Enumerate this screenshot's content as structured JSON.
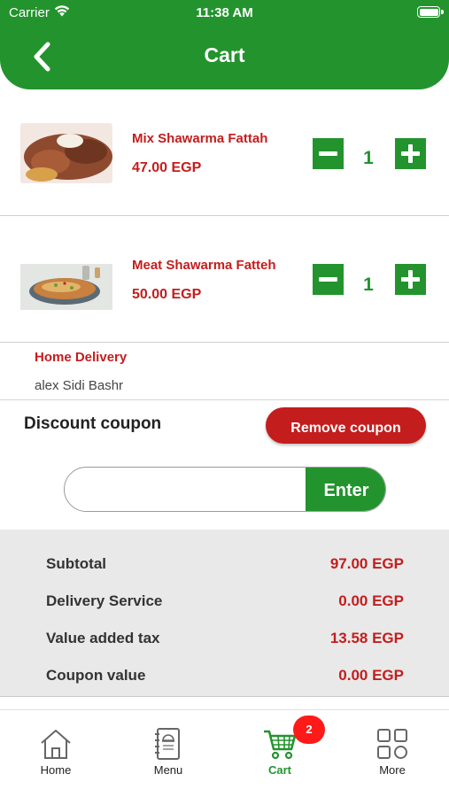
{
  "status_bar": {
    "carrier": "Carrier",
    "time": "11:38 AM"
  },
  "header": {
    "title": "Cart"
  },
  "cart": {
    "items": [
      {
        "name": "Mix Shawarma Fattah",
        "price": "47.00 EGP",
        "quantity": "1",
        "image": "shawarma-fattah-photo"
      },
      {
        "name": "Meat Shawarma Fatteh",
        "price": "50.00 EGP",
        "quantity": "1",
        "image": "meat-fatteh-photo"
      }
    ]
  },
  "delivery": {
    "type": "Home Delivery",
    "address": "alex  Sidi Bashr"
  },
  "coupon": {
    "label": "Discount coupon",
    "remove_label": "Remove coupon",
    "input_value": "",
    "enter_label": "Enter"
  },
  "summary": {
    "rows": [
      {
        "label": "Subtotal",
        "value": "97.00 EGP"
      },
      {
        "label": "Delivery Service",
        "value": "0.00 EGP"
      },
      {
        "label": "Value added tax",
        "value": "13.58 EGP"
      },
      {
        "label": "Coupon value",
        "value": "0.00 EGP"
      }
    ]
  },
  "tabbar": {
    "tabs": [
      {
        "label": "Home",
        "icon": "home-icon",
        "active": false
      },
      {
        "label": "Menu",
        "icon": "menu-book-icon",
        "active": false
      },
      {
        "label": "Cart",
        "icon": "cart-icon",
        "active": true
      },
      {
        "label": "More",
        "icon": "grid-icon",
        "active": false
      }
    ],
    "cart_badge": "2"
  },
  "colors": {
    "primary_green": "#23932e",
    "accent_red": "#c41d1d",
    "badge_red": "#ff1a1a",
    "summary_bg": "#e9e9e9"
  }
}
